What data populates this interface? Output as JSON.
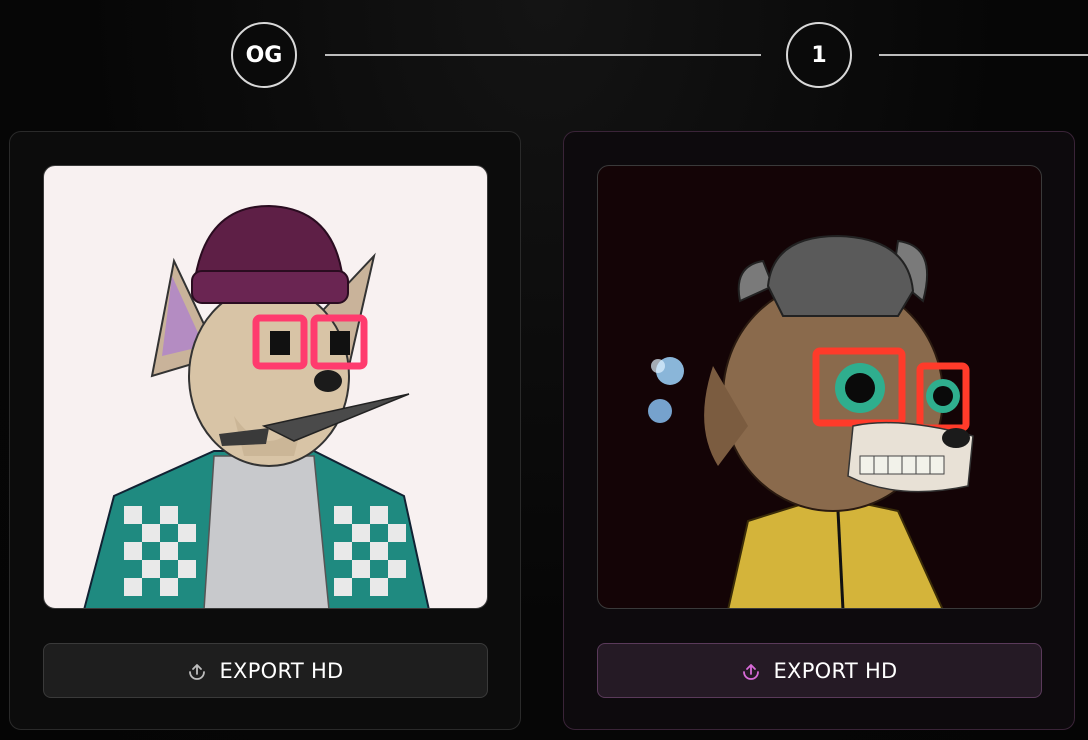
{
  "stepper": {
    "steps": [
      {
        "label": "OG"
      },
      {
        "label": "1"
      }
    ]
  },
  "cards": [
    {
      "image": {
        "subject": "dog-avatar-og",
        "background": "#f8f1f1"
      },
      "export": {
        "label": "EXPORT HD",
        "icon": "upload-icon",
        "icon_color": "#bdbdbd"
      }
    },
    {
      "image": {
        "subject": "goat-avatar-1",
        "background": "#140406"
      },
      "export": {
        "label": "EXPORT HD",
        "icon": "upload-icon",
        "icon_color": "#d86bd8"
      }
    }
  ]
}
